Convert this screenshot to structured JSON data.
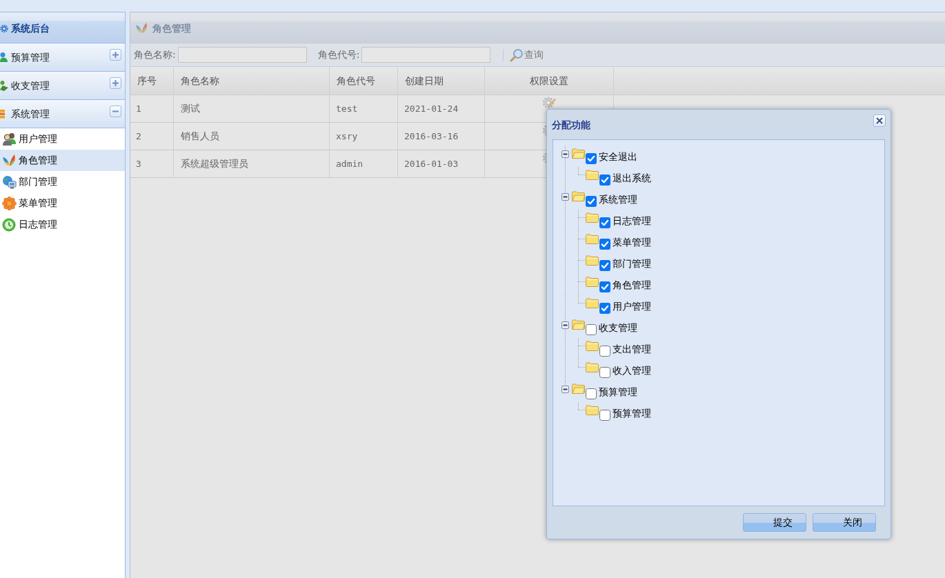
{
  "sidebar": {
    "title": "系统后台",
    "sections": [
      {
        "label": "预算管理",
        "expanded": false
      },
      {
        "label": "收支管理",
        "expanded": false
      },
      {
        "label": "系统管理",
        "expanded": true,
        "items": [
          {
            "label": "用户管理",
            "selected": false
          },
          {
            "label": "角色管理",
            "selected": true
          },
          {
            "label": "部门管理",
            "selected": false
          },
          {
            "label": "菜单管理",
            "selected": false
          },
          {
            "label": "日志管理",
            "selected": false
          }
        ]
      }
    ]
  },
  "main": {
    "title": "角色管理",
    "search": {
      "fields": [
        {
          "label": "角色名称:"
        },
        {
          "label": "角色代号:"
        }
      ],
      "button": "查询"
    },
    "table": {
      "columns": [
        "序号",
        "角色名称",
        "角色代号",
        "创建日期",
        "权限设置"
      ],
      "rows": [
        {
          "cells": [
            "1",
            "测试",
            "test",
            "2021-01-24"
          ]
        },
        {
          "cells": [
            "2",
            "销售人员",
            "xsry",
            "2016-03-16"
          ]
        },
        {
          "cells": [
            "3",
            "系统超级管理员",
            "admin",
            "2016-01-03"
          ]
        }
      ]
    }
  },
  "dialog": {
    "title": "分配功能",
    "tree": [
      {
        "label": "安全退出",
        "checked": true,
        "expanded": true,
        "children": [
          {
            "label": "退出系统",
            "checked": true
          }
        ]
      },
      {
        "label": "系统管理",
        "checked": true,
        "expanded": true,
        "children": [
          {
            "label": "日志管理",
            "checked": true
          },
          {
            "label": "菜单管理",
            "checked": true
          },
          {
            "label": "部门管理",
            "checked": true
          },
          {
            "label": "角色管理",
            "checked": true
          },
          {
            "label": "用户管理",
            "checked": true
          }
        ]
      },
      {
        "label": "收支管理",
        "checked": false,
        "expanded": true,
        "children": [
          {
            "label": "支出管理",
            "checked": false
          },
          {
            "label": "收入管理",
            "checked": false
          }
        ]
      },
      {
        "label": "预算管理",
        "checked": false,
        "expanded": true,
        "children": [
          {
            "label": "预算管理",
            "checked": false
          }
        ]
      }
    ],
    "buttons": [
      "提交",
      "关闭"
    ]
  }
}
